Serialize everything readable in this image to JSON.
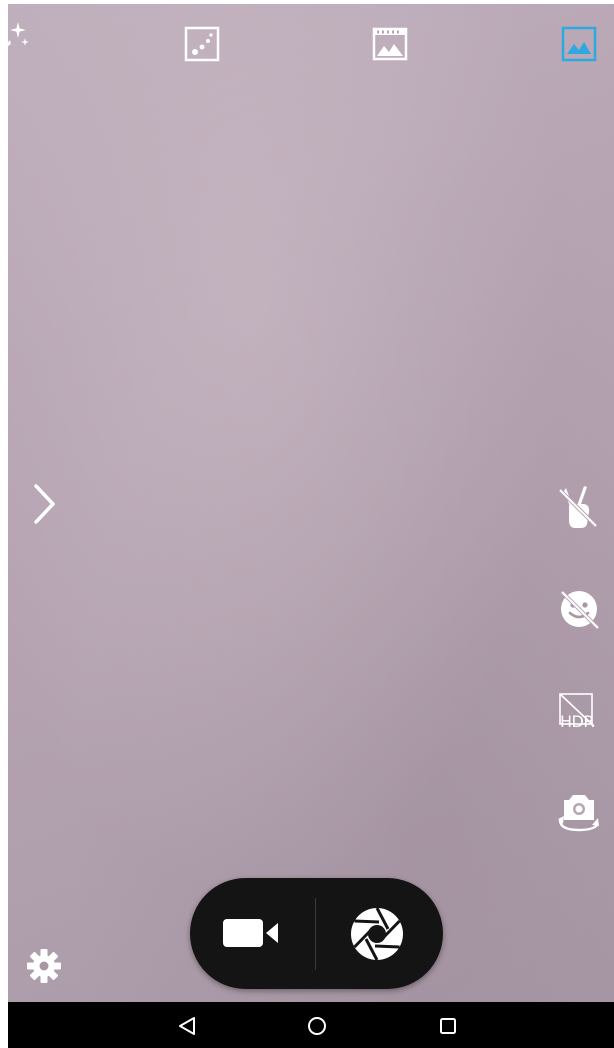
{
  "camera": {
    "top_modes": [
      {
        "name": "effects",
        "icon": "sparkle-icon"
      },
      {
        "name": "panorama-dots",
        "icon": "dots-frame-icon"
      },
      {
        "name": "film",
        "icon": "filmstrip-image-icon"
      },
      {
        "name": "gallery",
        "icon": "image-icon",
        "active": true
      }
    ],
    "side_controls": [
      {
        "name": "gesture-shot-off",
        "icon": "victory-hand-off-icon"
      },
      {
        "name": "smile-shot-off",
        "icon": "smile-off-icon"
      },
      {
        "name": "hdr-off",
        "icon": "hdr-off-icon",
        "label": "HDR"
      },
      {
        "name": "switch-camera",
        "icon": "camera-switch-icon"
      }
    ],
    "hdr_label": "HDR",
    "expand_icon": "chevron-right-icon",
    "settings_icon": "gear-icon",
    "shutter": {
      "video_icon": "video-camera-icon",
      "photo_icon": "aperture-icon"
    }
  },
  "navbar": {
    "back_icon": "back-triangle-icon",
    "home_icon": "home-circle-icon",
    "recents_icon": "recents-square-icon"
  },
  "colors": {
    "accent": "#2fa8e0",
    "viewfinder": "#b7a5b4",
    "shutter_bg": "#141414",
    "navbar_bg": "#000000"
  }
}
